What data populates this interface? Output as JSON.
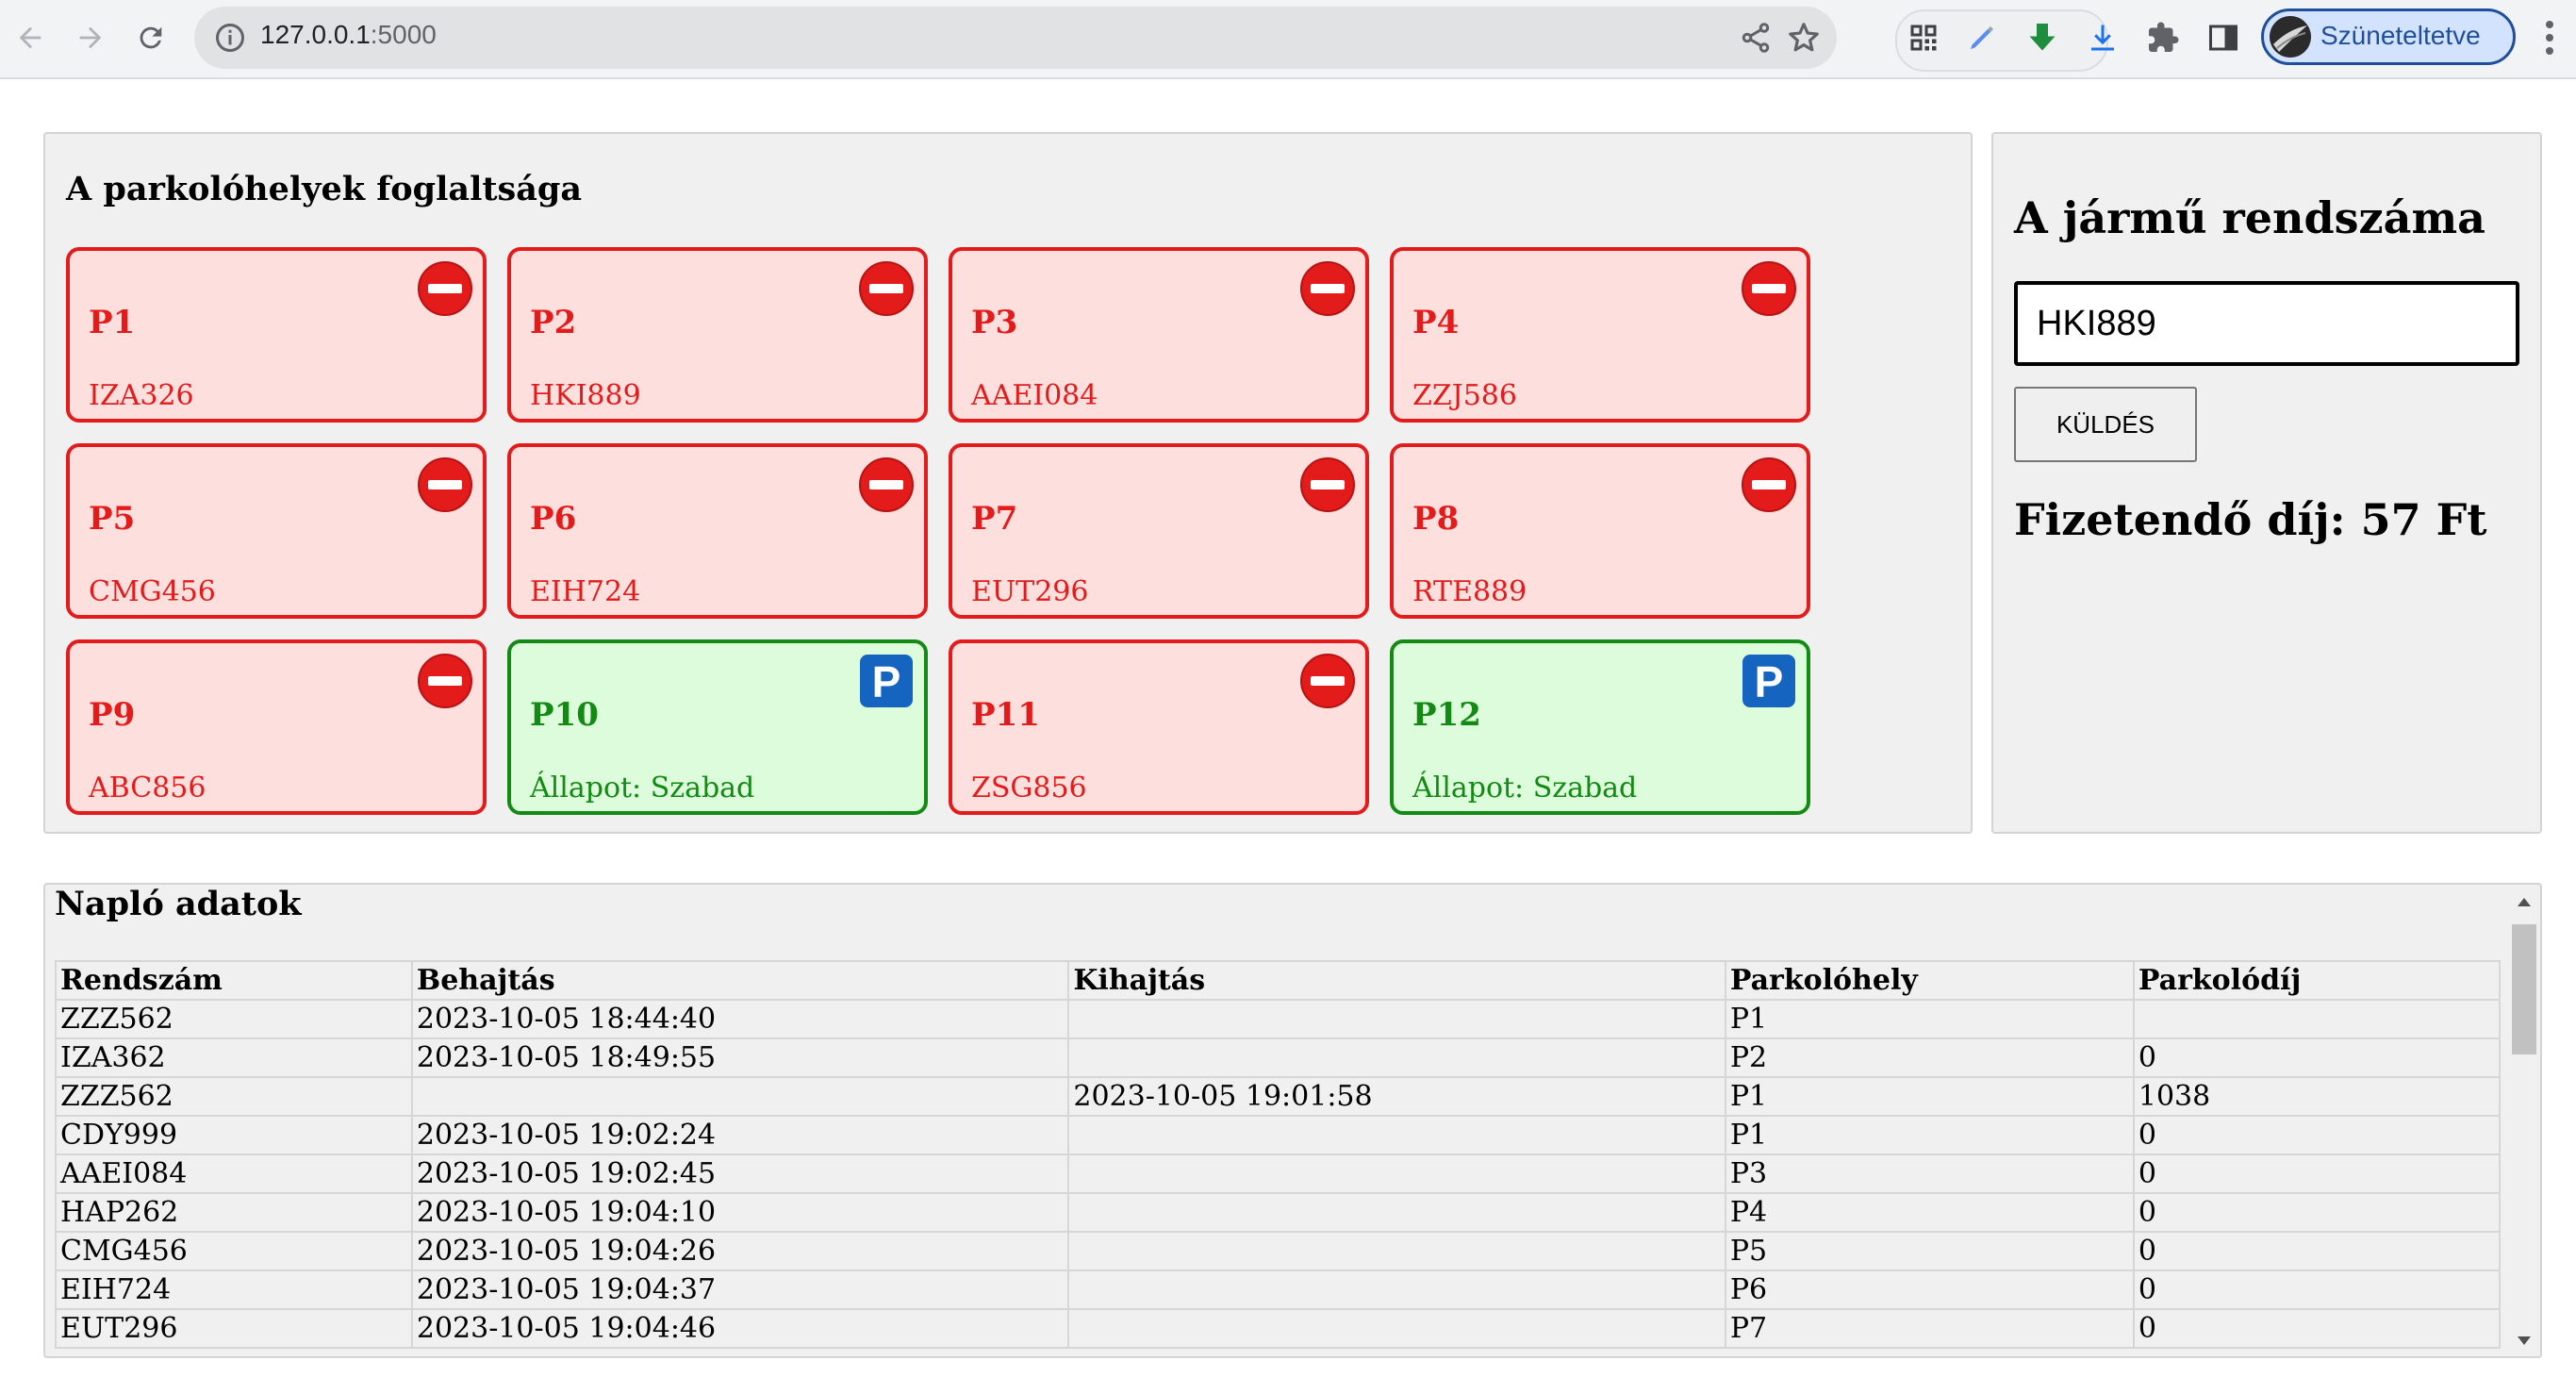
{
  "browser": {
    "url_host": "127.0.0.1",
    "url_port": ":5000",
    "profile_label": "Szüneteltetve"
  },
  "parking": {
    "title": "A parkolóhelyek foglaltsága",
    "spots": [
      {
        "name": "P1",
        "text": "IZA326",
        "status": "occupied"
      },
      {
        "name": "P2",
        "text": "HKI889",
        "status": "occupied"
      },
      {
        "name": "P3",
        "text": "AAEI084",
        "status": "occupied"
      },
      {
        "name": "P4",
        "text": "ZZJ586",
        "status": "occupied"
      },
      {
        "name": "P5",
        "text": "CMG456",
        "status": "occupied"
      },
      {
        "name": "P6",
        "text": "EIH724",
        "status": "occupied"
      },
      {
        "name": "P7",
        "text": "EUT296",
        "status": "occupied"
      },
      {
        "name": "P8",
        "text": "RTE889",
        "status": "occupied"
      },
      {
        "name": "P9",
        "text": "ABC856",
        "status": "occupied"
      },
      {
        "name": "P10",
        "text": "Állapot: Szabad",
        "status": "free"
      },
      {
        "name": "P11",
        "text": "ZSG856",
        "status": "occupied"
      },
      {
        "name": "P12",
        "text": "Állapot: Szabad",
        "status": "free"
      }
    ],
    "colors": {
      "occupied": "#e31b1b",
      "free": "#138a13",
      "parking_sign": "#1565c0"
    }
  },
  "plate_form": {
    "title": "A jármű rendszáma",
    "input_value": "HKI889",
    "button_label": "KÜLDÉS",
    "fee_text": "Fizetendő díj: 57 Ft"
  },
  "log": {
    "title": "Napló adatok",
    "columns": [
      "Rendszám",
      "Behajtás",
      "Kihajtás",
      "Parkolóhely",
      "Parkolódíj"
    ],
    "rows": [
      [
        "ZZZ562",
        "2023-10-05 18:44:40",
        "",
        "P1",
        ""
      ],
      [
        "IZA362",
        "2023-10-05 18:49:55",
        "",
        "P2",
        "0"
      ],
      [
        "ZZZ562",
        "",
        "2023-10-05 19:01:58",
        "P1",
        "1038"
      ],
      [
        "CDY999",
        "2023-10-05 19:02:24",
        "",
        "P1",
        "0"
      ],
      [
        "AAEI084",
        "2023-10-05 19:02:45",
        "",
        "P3",
        "0"
      ],
      [
        "HAP262",
        "2023-10-05 19:04:10",
        "",
        "P4",
        "0"
      ],
      [
        "CMG456",
        "2023-10-05 19:04:26",
        "",
        "P5",
        "0"
      ],
      [
        "EIH724",
        "2023-10-05 19:04:37",
        "",
        "P6",
        "0"
      ],
      [
        "EUT296",
        "2023-10-05 19:04:46",
        "",
        "P7",
        "0"
      ]
    ]
  }
}
